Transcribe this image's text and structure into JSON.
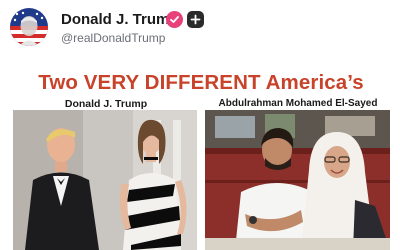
{
  "post": {
    "display_name": "Donald J. Trump",
    "handle": "@realDonaldTrump",
    "avatar_icon": "flag-portrait-avatar",
    "verified_icon": "verified-check-icon",
    "plus_icon": "plus-icon"
  },
  "media": {
    "headline": "Two VERY DIFFERENT America’s",
    "left_caption": "Donald J. Trump",
    "right_caption": "Abdulrahman Mohamed El-Sayed",
    "left_photo": "couple in formal black-tie attire",
    "right_photo": "couple seated at a restaurant booth"
  },
  "colors": {
    "headline": "#c8432a",
    "verified_badge": "#e8407a",
    "plus_button": "#2b2b2b",
    "handle_text": "#6b6f76"
  }
}
